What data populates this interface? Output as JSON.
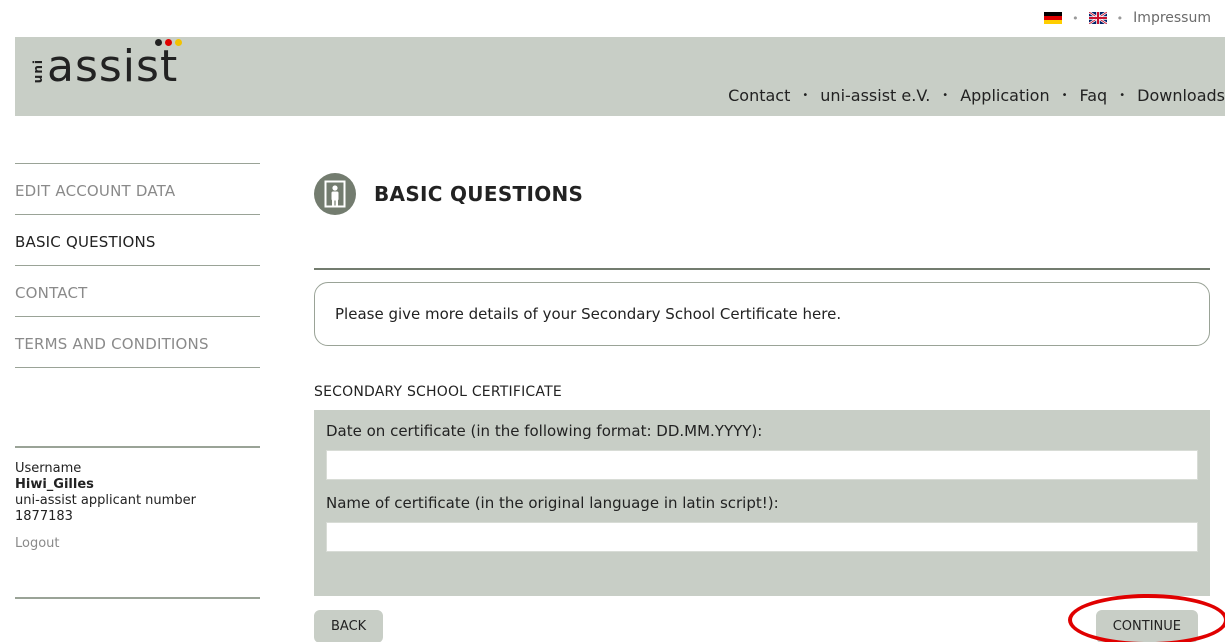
{
  "topbar": {
    "language_de_icon": "flag-germany-icon",
    "language_en_icon": "flag-uk-icon",
    "separator": "•",
    "impressum": "Impressum"
  },
  "header": {
    "logo_prefix": "uni",
    "logo_text": "assist",
    "nav": [
      {
        "label": "Contact"
      },
      {
        "label": "uni-assist e.V."
      },
      {
        "label": "Application"
      },
      {
        "label": "Faq"
      },
      {
        "label": "Downloads"
      }
    ],
    "nav_separator": "•"
  },
  "sidebar": {
    "items": [
      {
        "label": "EDIT ACCOUNT DATA",
        "active": false
      },
      {
        "label": "BASIC QUESTIONS",
        "active": true
      },
      {
        "label": "CONTACT",
        "active": false
      },
      {
        "label": "TERMS AND CONDITIONS",
        "active": false
      }
    ],
    "user": {
      "username_label": "Username",
      "username": "Hiwi_Gilles",
      "applicant_label": "uni-assist applicant number",
      "applicant_number": "1877183",
      "logout": "Logout"
    }
  },
  "main": {
    "icon": "door-person-icon",
    "title": "BASIC QUESTIONS",
    "info": "Please give more details of your Secondary School Certificate here.",
    "section_label": "SECONDARY SCHOOL CERTIFICATE",
    "fields": [
      {
        "label": "Date on certificate (in the following format: DD.MM.YYYY):",
        "value": "",
        "placeholder": ""
      },
      {
        "label": "Name of certificate (in the original language in latin script!):",
        "value": "",
        "placeholder": ""
      }
    ],
    "back_label": "BACK",
    "continue_label": "CONTINUE"
  },
  "colors": {
    "band": "#c8cec6",
    "accent": "#737c6f",
    "highlight": "#e00000"
  }
}
